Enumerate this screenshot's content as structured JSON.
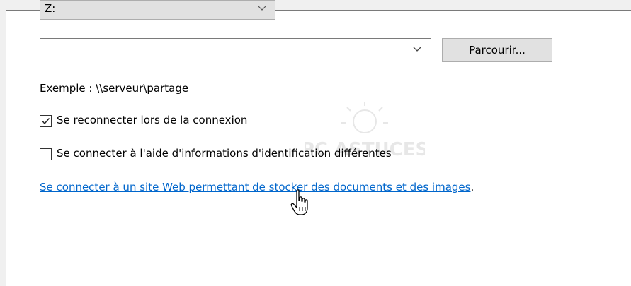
{
  "drive": {
    "value": "Z:"
  },
  "folder": {
    "value": "",
    "browse_label": "Parcourir..."
  },
  "example_text": "Exemple : \\\\serveur\\partage",
  "options": [
    {
      "label": "Se reconnecter lors de la connexion",
      "checked": true
    },
    {
      "label": "Se connecter à l'aide d'informations d'identification différentes",
      "checked": false
    }
  ],
  "link": {
    "text": "Se connecter à un site Web permettant de stocker des documents et des images",
    "trailing": "."
  },
  "watermark_text": "PC ASTUCES",
  "icons": {
    "chevron": "chevron-down-icon",
    "check": "checkmark-icon",
    "cursor": "hand-pointer-cursor-icon"
  }
}
